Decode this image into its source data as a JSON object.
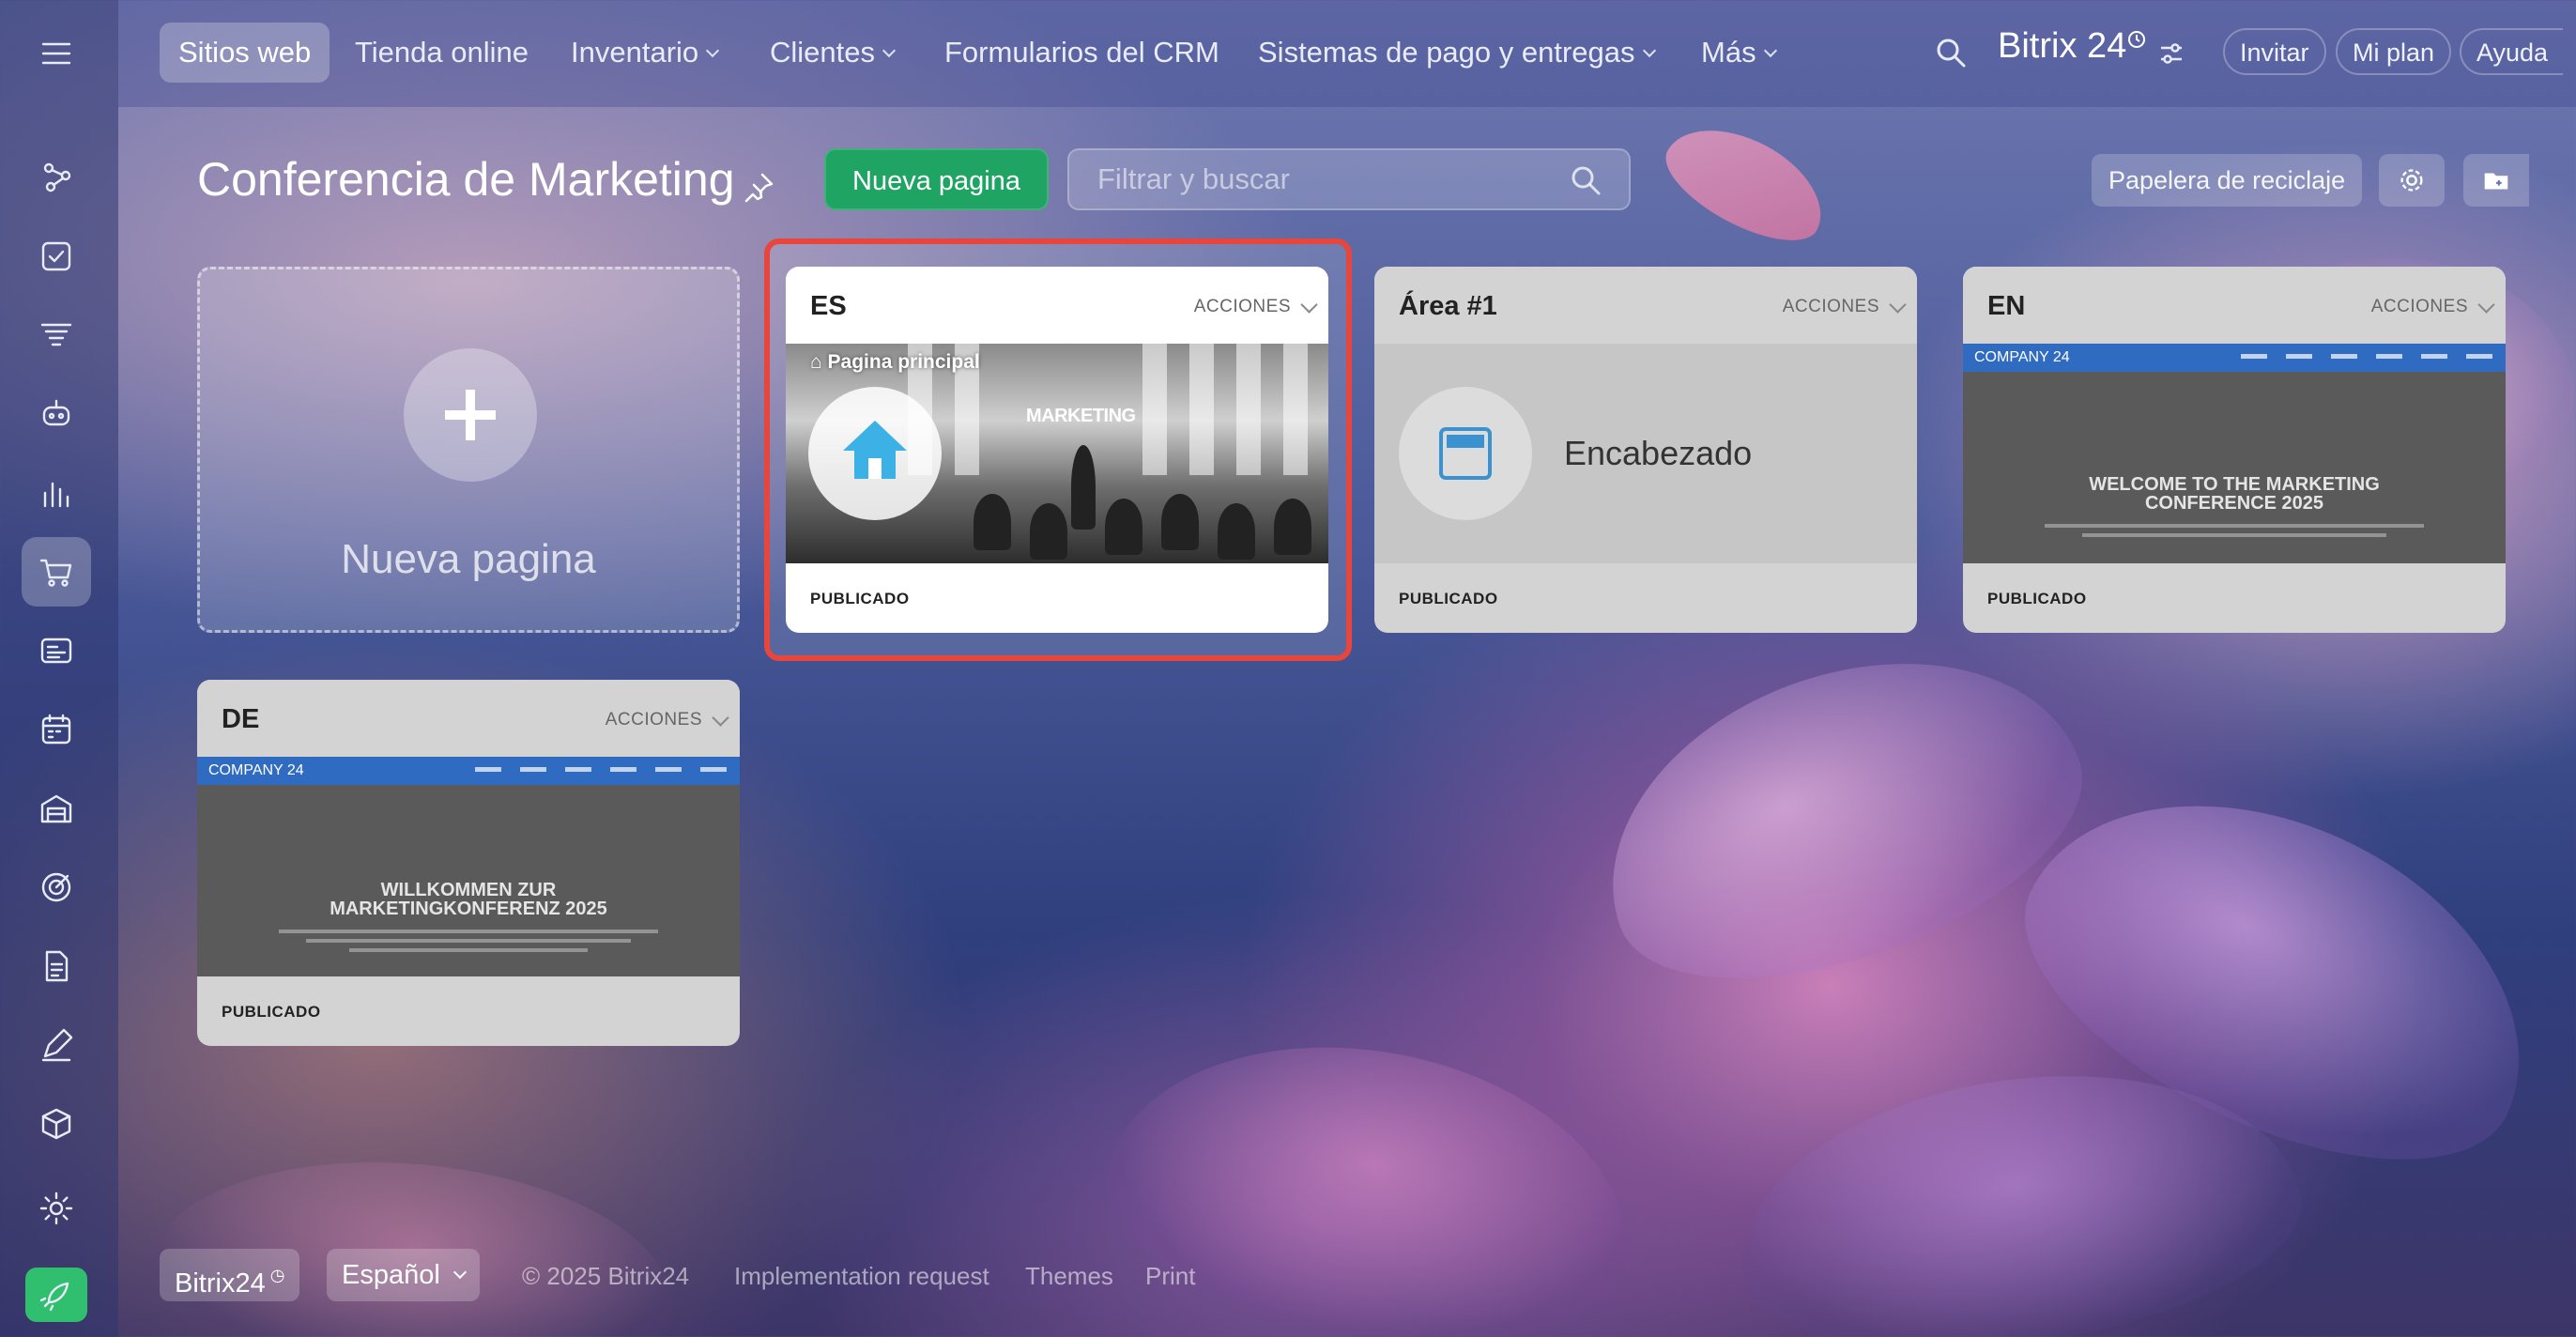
{
  "nav": {
    "items": [
      "Sitios web",
      "Tienda online",
      "Inventario",
      "Clientes",
      "Formularios del CRM",
      "Sistemas de pago y entregas",
      "Más"
    ],
    "brand": "Bitrix 24",
    "invite": "Invitar",
    "plan": "Mi plan",
    "help": "Ayuda"
  },
  "sidebar": {
    "icons": [
      "menu-icon",
      "workflow-icon",
      "tasks-icon",
      "funnel-icon",
      "robot-icon",
      "analytics-icon",
      "shop-icon",
      "contact-card-icon",
      "calendar-icon",
      "warehouse-icon",
      "target-icon",
      "document-icon",
      "sign-icon",
      "package-icon",
      "settings-icon",
      "rocket-icon"
    ],
    "active": "shop-icon",
    "accent": "#2fbf6e"
  },
  "header": {
    "title": "Conferencia de Marketing",
    "new_page": "Nueva pagina",
    "search_placeholder": "Filtrar y buscar",
    "trash": "Papelera de reciclaje"
  },
  "new_card_label": "Nueva pagina",
  "cards": {
    "es": {
      "title": "ES",
      "actions": "ACCIONES",
      "home_tag": "Pagina principal",
      "sign": "MARKETING",
      "status": "PUBLICADO"
    },
    "area": {
      "title": "Área #1",
      "actions": "ACCIONES",
      "label": "Encabezado",
      "status": "PUBLICADO"
    },
    "en": {
      "title": "EN",
      "actions": "ACCIONES",
      "logo": "COMPANY 24",
      "headline_1": "WELCOME TO THE MARKETING",
      "headline_2": "CONFERENCE 2025",
      "status": "PUBLICADO"
    },
    "de": {
      "title": "DE",
      "actions": "ACCIONES",
      "logo": "COMPANY 24",
      "headline_1": "WILLKOMMEN ZUR",
      "headline_2": "MARKETINGKONFERENZ 2025",
      "status": "PUBLICADO"
    }
  },
  "colors": {
    "highlight": "#e8453c",
    "primary_button": "#1fa463",
    "site_nav": "#2f6bc1"
  },
  "footer": {
    "brand": "Bitrix24",
    "language": "Español",
    "copyright": "© 2025 Bitrix24",
    "implementation": "Implementation request",
    "themes": "Themes",
    "print": "Print"
  }
}
